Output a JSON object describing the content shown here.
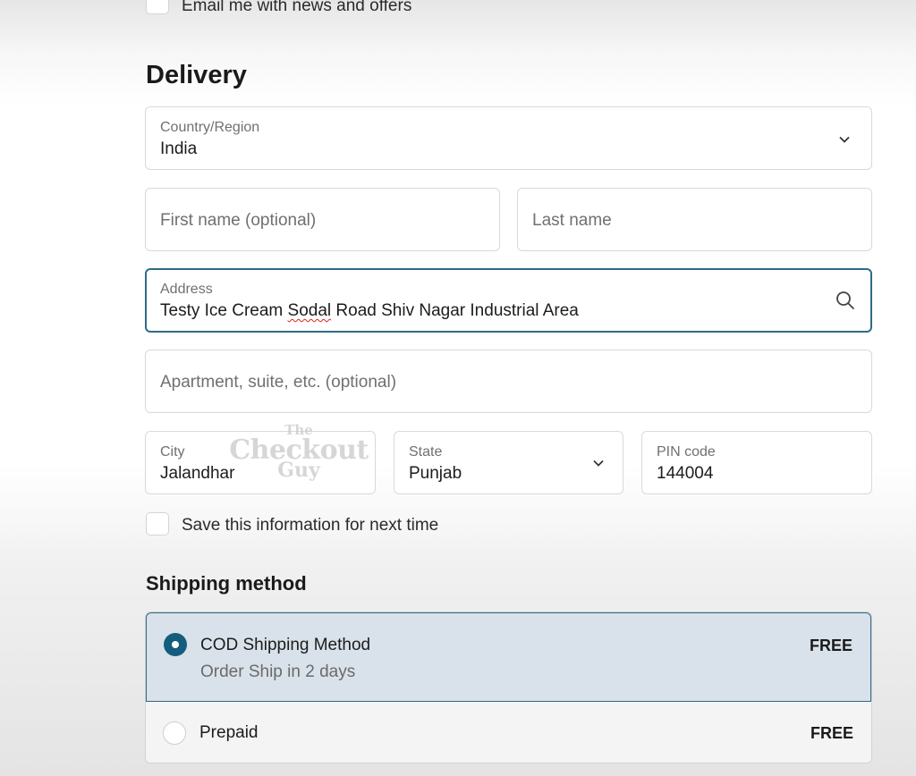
{
  "marketing": {
    "email_opt_in_label": "Email me with news and offers"
  },
  "delivery": {
    "title": "Delivery",
    "country": {
      "label": "Country/Region",
      "value": "India"
    },
    "first_name": {
      "placeholder": "First name (optional)"
    },
    "last_name": {
      "placeholder": "Last name"
    },
    "address": {
      "label": "Address",
      "value_before": "Testy Ice Cream ",
      "value_misspelled": "Sodal",
      "value_after": " Road Shiv Nagar Industrial Area"
    },
    "apartment": {
      "placeholder": "Apartment, suite, etc. (optional)"
    },
    "city": {
      "label": "City",
      "value": "Jalandhar"
    },
    "state": {
      "label": "State",
      "value": "Punjab"
    },
    "pin": {
      "label": "PIN code",
      "value": "144004"
    },
    "save_info_label": "Save this information for next time"
  },
  "watermark": {
    "line1": "The",
    "line2": "Checkout",
    "line3": "Guy"
  },
  "shipping": {
    "title": "Shipping method",
    "options": [
      {
        "name": "COD Shipping Method",
        "description": "Order Ship in 2 days",
        "price": "FREE",
        "selected": true
      },
      {
        "name": "Prepaid",
        "price": "FREE",
        "selected": false
      }
    ]
  },
  "colors": {
    "accent": "#155d7c",
    "focus_border": "#2e6b86",
    "selected_bg": "#d9e2ea"
  },
  "icons": {
    "dropdown": "chevron-down-icon",
    "search": "search-icon"
  }
}
